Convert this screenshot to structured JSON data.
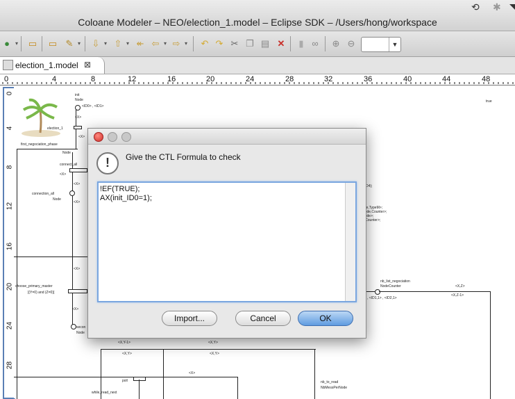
{
  "window": {
    "title": "Coloane Modeler – NEO/election_1.model – Eclipse SDK – /Users/hong/workspace"
  },
  "tab": {
    "label": "election_1.model",
    "close": "⊠"
  },
  "ruler": {
    "h_ticks": [
      "0",
      "4",
      "8",
      "12",
      "16",
      "20",
      "24",
      "28",
      "32",
      "36",
      "40",
      "44",
      "48"
    ],
    "v_ticks": [
      "0",
      "4",
      "8",
      "12",
      "16",
      "20",
      "24",
      "28"
    ]
  },
  "canvas": {
    "labels": {
      "init": "init",
      "init_node": "Node",
      "init_vals": "<ID0> , <ID1>",
      "election_1": "election_1",
      "x1": "<X>",
      "x2": "<X>",
      "first_neg": "first_negociation_phase",
      "node1": "Node",
      "connect_all": "connect_all",
      "connection_all": "connection_all",
      "node2": "Node",
      "x3": "<X>",
      "x4": "<X>",
      "x5": "<X>",
      "x6": "<X>",
      "choose": "choose_primary_master",
      "guard": "[(Y=0) and (Z=0)]",
      "x7": "<X>",
      "second": "secon",
      "node3": "Node",
      "xy_minus": "<X,Y-1>",
      "xy1": "<X,Y>",
      "xy2": "<X,Y>",
      "xy3": "<X,Y>",
      "poll": "poll",
      "x8": "<X>",
      "while": "while_read_next",
      "nb_read": "nb_to_read",
      "nb_read_type": "NbMessPerNode",
      "nb_list": "nb_list_negociation",
      "node_counter": "NodeCounter",
      "xz": "<X,Z>",
      "xz_minus": "<X,Z-1>",
      "id_vals": ") , <ID1,1> , <ID2,1>",
      "true_lbl": "true",
      "right_text1": "(ID4);",
      "right_text2": "ode,TypeM>;",
      "right_text3": "Node,Counter>;",
      "right_text4": "Node>;",
      "right_text5": "e,Counter>;",
      "right_text6": ">;"
    }
  },
  "dialog": {
    "prompt": "Give the CTL Formula to check",
    "formula_lines": [
      "!EF(TRUE);",
      "AX(init_ID0=1);"
    ],
    "buttons": {
      "import": "Import...",
      "cancel": "Cancel",
      "ok": "OK"
    },
    "icon": "exclamation-icon"
  },
  "colors": {
    "accent": "#5f9be0",
    "close_red": "#e0443e",
    "ruler_blue": "#5a7fb5"
  }
}
